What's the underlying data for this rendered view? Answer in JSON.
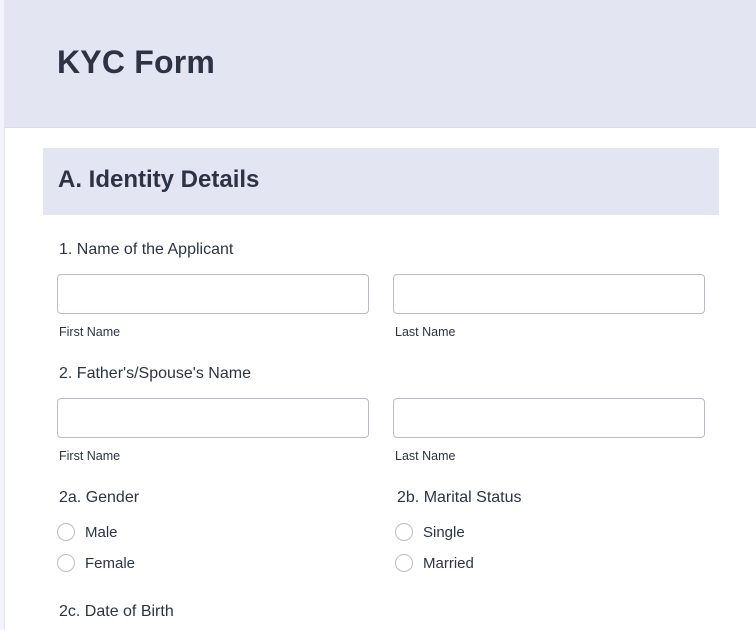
{
  "form": {
    "title": "KYC Form"
  },
  "section_a": {
    "title": "A. Identity Details"
  },
  "q1": {
    "label": "1. Name of the Applicant",
    "first_value": "",
    "last_value": "",
    "first_sublabel": "First Name",
    "last_sublabel": "Last Name"
  },
  "q2": {
    "label": "2. Father's/Spouse's Name",
    "first_value": "",
    "last_value": "",
    "first_sublabel": "First Name",
    "last_sublabel": "Last Name"
  },
  "q2a": {
    "label": "2a. Gender",
    "options": [
      "Male",
      "Female"
    ],
    "selected": null
  },
  "q2b": {
    "label": "2b. Marital Status",
    "options": [
      "Single",
      "Married"
    ],
    "selected": null
  },
  "q2c": {
    "label": "2c. Date of Birth"
  },
  "colors": {
    "header_bg": "#e3e5f3",
    "outer_bg": "#f3f3fe",
    "text": "#2c3345",
    "input_border": "#b8bdc9"
  }
}
